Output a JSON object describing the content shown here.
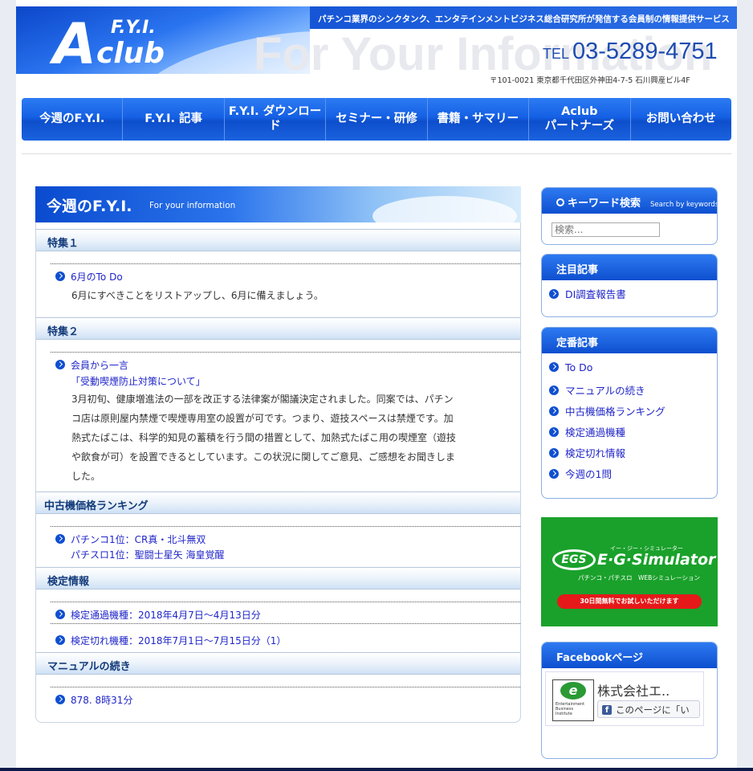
{
  "header": {
    "logo_fyi": "F.Y.I.",
    "logo_a": "A",
    "logo_club": "club",
    "tagline": "パチンコ業界のシンクタンク、エンタテインメントビジネス総合研究所が発信する会員制の情報提供サービス",
    "watermark": "For Your Information",
    "tel_label": "TEL",
    "tel_number": "03-5289-4751",
    "address": "〒101-0021 東京都千代田区外神田4-7-5 石川興産ビル4F"
  },
  "nav": [
    {
      "label": "今週のF.Y.I."
    },
    {
      "label": "F.Y.I. 記事"
    },
    {
      "label": "F.Y.I. ダウンロード"
    },
    {
      "label": "セミナー・研修"
    },
    {
      "label": "書籍・サマリー"
    },
    {
      "label": "Aclub\nパートナーズ"
    },
    {
      "label": "お問い合わせ"
    }
  ],
  "main": {
    "title": "今週のF.Y.I.",
    "subtitle": "For your information",
    "sections": [
      {
        "heading": "特集１",
        "items": [
          {
            "link": "6月のTo Do"
          }
        ],
        "body": "6月にすべきことをリストアップし、6月に備えましょう。"
      },
      {
        "heading": "特集２",
        "items": [
          {
            "link": "会員から一言",
            "link2": "「受動喫煙防止対策について」"
          }
        ],
        "body_lines": [
          "3月初旬、健康増進法の一部を改正する法律案が閣議決定されました。同案では、パチン",
          "コ店は原則屋内禁煙で喫煙専用室の設置が可です。つまり、遊技スペースは禁煙です。加",
          "熱式たばこは、科学的知見の蓄積を行う間の措置として、加熱式たばこ用の喫煙室（遊技",
          "や飲食が可）を設置できるとしています。この状況に関してご意見、ご感想をお聞きしま",
          "した。"
        ]
      },
      {
        "heading": "中古機価格ランキング",
        "items": [
          {
            "link": "パチンコ1位：CR真・北斗無双",
            "link2": "パチスロ1位：聖闘士星矢 海皇覚醒"
          }
        ]
      },
      {
        "heading": "検定情報",
        "items": [
          {
            "link": "検定通過機種：2018年4月7日〜4月13日分"
          },
          {
            "link": "検定切れ機種：2018年7月1日〜7月15日分（1）"
          }
        ]
      },
      {
        "heading": "マニュアルの続き",
        "items": [
          {
            "link": "878. 8時31分"
          }
        ]
      }
    ]
  },
  "sidebar": {
    "search": {
      "title": "キーワード検索",
      "subtitle": "Search by keywords",
      "placeholder": "検索..."
    },
    "featured": {
      "title": "注目記事",
      "items": [
        "DI調査報告書"
      ]
    },
    "regular": {
      "title": "定番記事",
      "items": [
        "To Do",
        "マニュアルの続き",
        "中古機価格ランキング",
        "検定通過機種",
        "検定切れ情報",
        "今週の1問"
      ]
    },
    "banner": {
      "logo": "EGS",
      "ruby": "イー・ジー・シミュレーター",
      "name": "E·G·Simulator",
      "sub": "パチンコ・パチスロ　WEBシミュレーション",
      "cta": "30日間無料でお試しいただけます"
    },
    "facebook": {
      "title": "Facebookページ",
      "page_name": "株式会社エ..",
      "logo_mark": "e",
      "logo_lines": [
        "Entertainment",
        "Business",
        "Institute"
      ],
      "like_label": "このページに「い",
      "fb_icon": "f"
    }
  }
}
